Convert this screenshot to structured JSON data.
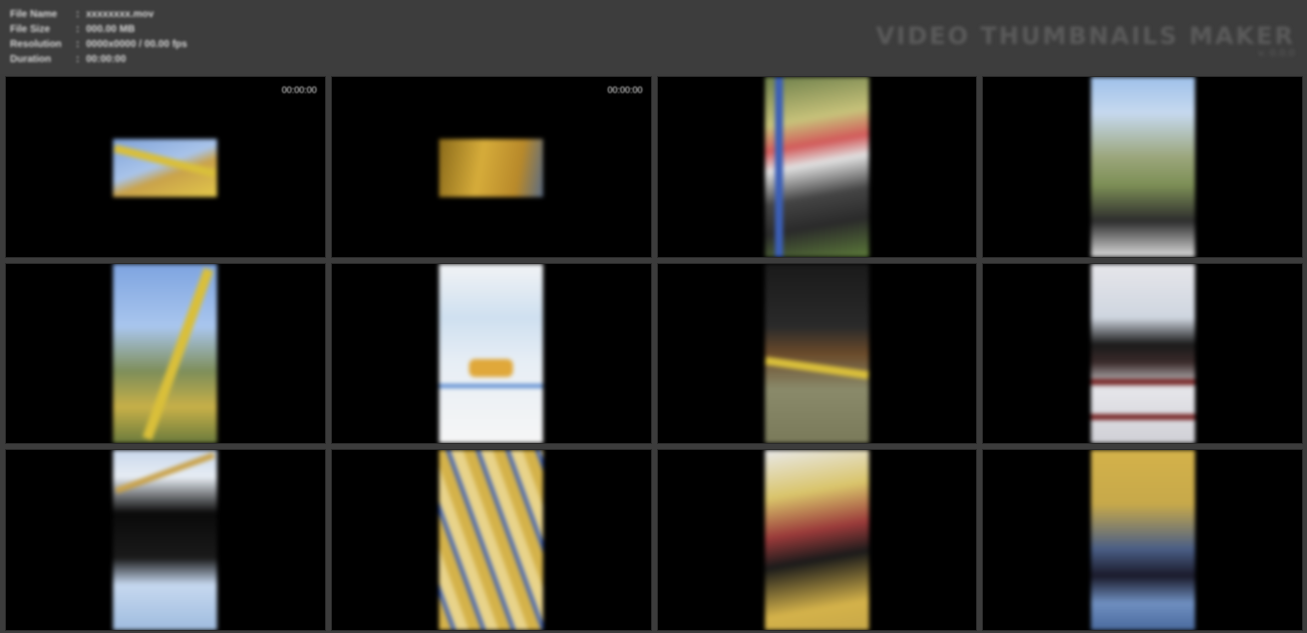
{
  "header": {
    "meta": [
      {
        "label": "File Name",
        "value": "xxxxxxxx.mov"
      },
      {
        "label": "File Size",
        "value": "000.00 MB"
      },
      {
        "label": "Resolution",
        "value": "0000x0000 / 00.00 fps"
      },
      {
        "label": "Duration",
        "value": "00:00:00"
      }
    ],
    "brand_title": "VIDEO THUMBNAILS MAKER",
    "brand_sub": "v. 0.0.0"
  },
  "thumbnails": [
    {
      "timestamp": "00:00:00",
      "scene": "sky-yellow"
    },
    {
      "timestamp": "00:00:00",
      "scene": "gold-bar"
    },
    {
      "timestamp": "",
      "scene": "playground-red"
    },
    {
      "timestamp": "",
      "scene": "sky-tree"
    },
    {
      "timestamp": "",
      "scene": "sky-yellow-frame"
    },
    {
      "timestamp": "",
      "scene": "bright-white"
    },
    {
      "timestamp": "",
      "scene": "dark-ground"
    },
    {
      "timestamp": "",
      "scene": "white-dark-bars"
    },
    {
      "timestamp": "",
      "scene": "sky-dark-corner"
    },
    {
      "timestamp": "",
      "scene": "yellow-blue-grid"
    },
    {
      "timestamp": "",
      "scene": "yellow-white-red"
    },
    {
      "timestamp": "",
      "scene": "yellow-blue-person"
    }
  ],
  "colors": {
    "background": "#3c3c3c",
    "cell": "#000000",
    "header_text": "#d6d6d6",
    "brand_text": "#5a5a5a"
  }
}
